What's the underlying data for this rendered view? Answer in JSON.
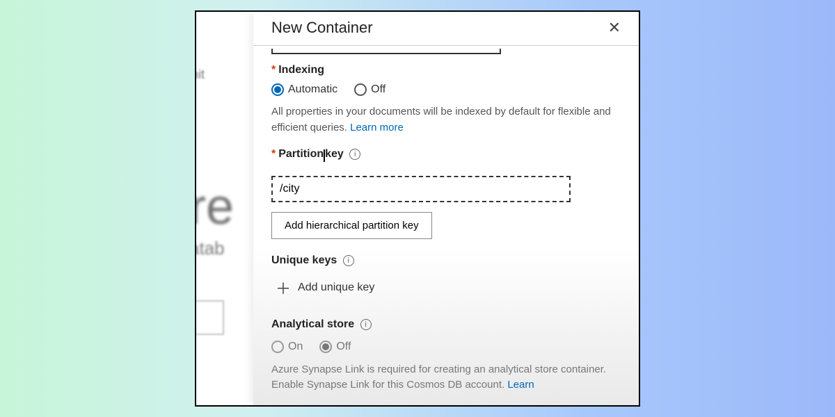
{
  "background": {
    "fragment1": "limit",
    "fragment2": "re",
    "fragment3": "atab"
  },
  "panel": {
    "title": "New Container",
    "indexing": {
      "label": "Indexing",
      "opt_auto": "Automatic",
      "opt_off": "Off",
      "help_a": "All properties in your documents will be indexed by default for flexible and efficient queries. ",
      "learn_more": "Learn more"
    },
    "partition": {
      "label_prefix": "Partition",
      "label_suffix": "key",
      "value": "/city",
      "add_hier": "Add hierarchical partition key"
    },
    "unique": {
      "label": "Unique keys",
      "add": "Add unique key"
    },
    "analytical": {
      "label": "Analytical store",
      "opt_on": "On",
      "opt_off": "Off",
      "help_a": "Azure Synapse Link is required for creating an analytical store container. Enable Synapse Link for this Cosmos DB account. ",
      "learn_more": "Learn"
    }
  }
}
